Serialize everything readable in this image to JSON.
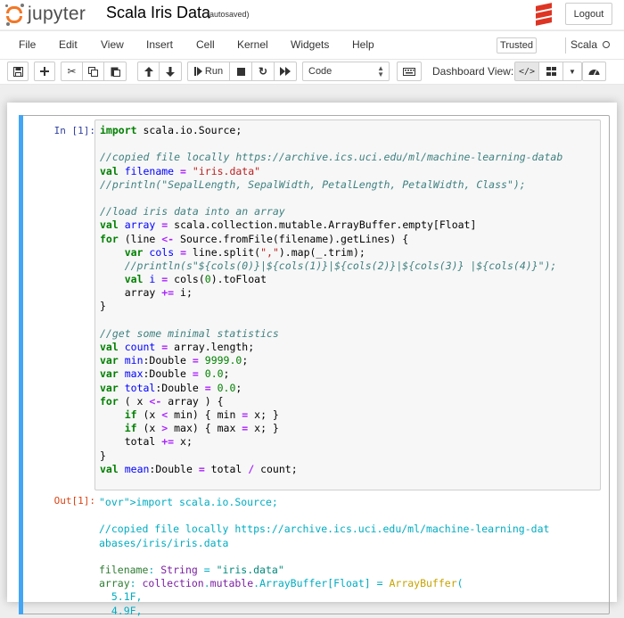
{
  "header": {
    "logo_text": "jupyter",
    "notebook_name": "Scala Iris Data",
    "autosave_status": "(autosaved)",
    "logout_label": "Logout"
  },
  "menubar": {
    "items": [
      "File",
      "Edit",
      "View",
      "Insert",
      "Cell",
      "Kernel",
      "Widgets",
      "Help"
    ],
    "trusted_label": "Trusted",
    "kernel_name": "Scala"
  },
  "toolbar": {
    "run_label": "Run",
    "cell_type": "Code",
    "dashboard_label": "Dashboard View:"
  },
  "cell": {
    "in_prompt": "In [1]:",
    "out_prompt": "Out[1]:",
    "code": [
      "import scala.io.Source;",
      "",
      "//copied file locally https://archive.ics.uci.edu/ml/machine-learning-datab",
      "val filename = \"iris.data\"",
      "//println(\"SepalLength, SepalWidth, PetalLength, PetalWidth, Class\");",
      "",
      "//load iris data into an array",
      "val array = scala.collection.mutable.ArrayBuffer.empty[Float]",
      "for (line <- Source.fromFile(filename).getLines) {",
      "    var cols = line.split(\",\").map(_.trim);",
      "    //println(s\"${cols(0)}|${cols(1)}|${cols(2)}|${cols(3)} |${cols(4)}\");",
      "    val i = cols(0).toFloat",
      "    array += i;",
      "}",
      "",
      "//get some minimal statistics",
      "val count = array.length;",
      "var min:Double = 9999.0;",
      "var max:Double = 0.0;",
      "var total:Double = 0.0;",
      "for ( x <- array ) {",
      "    if (x < min) { min = x; }",
      "    if (x > max) { max = x; }",
      "    total += x;",
      "}",
      "val mean:Double = total / count;"
    ],
    "output": [
      "import scala.io.Source;",
      "",
      "//copied file locally https://archive.ics.uci.edu/ml/machine-learning-dat",
      "abases/iris/iris.data",
      "",
      "filename: String = \"iris.data\"",
      "array: collection.mutable.ArrayBuffer[Float] = ArrayBuffer(",
      "  5.1F,",
      "  4.9F,"
    ]
  },
  "colors": {
    "jupyter_orange": "#f37726",
    "scala_red": "#de3423",
    "cell_selected_bar": "#42a5f5",
    "in_prompt": "#303f9f",
    "out_prompt": "#d84315",
    "keyword": "#008000",
    "comment": "#408080",
    "string": "#ba2121",
    "variable": "#0000ff"
  },
  "icons": [
    "save-icon",
    "plus-icon",
    "scissors-icon",
    "copy-icon",
    "paste-icon",
    "arrow-up-icon",
    "arrow-down-icon",
    "step-forward-icon",
    "stop-icon",
    "refresh-icon",
    "fast-forward-icon",
    "keyboard-icon",
    "code-icon",
    "grid-icon",
    "caret-down-icon",
    "dashboard-icon"
  ]
}
